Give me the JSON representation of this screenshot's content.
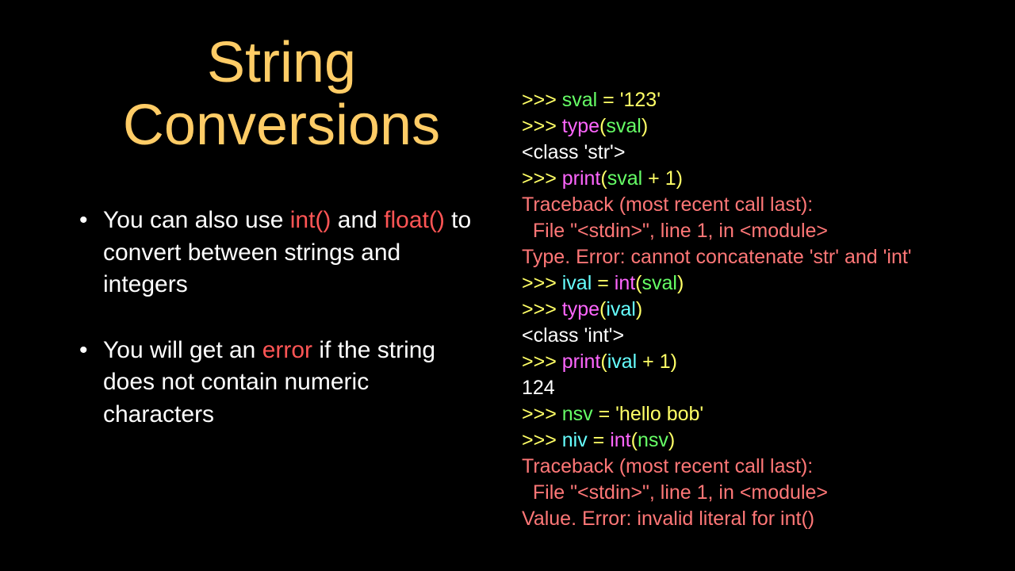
{
  "title_line1": "String",
  "title_line2": "Conversions",
  "bullets": {
    "b1_pre": "You can also use ",
    "b1_int": "int()",
    "b1_mid": " and ",
    "b1_float": "float()",
    "b1_post": " to convert between strings and integers",
    "b2_pre": "You will get an ",
    "b2_err": "error",
    "b2_post": " if the string does not contain numeric characters"
  },
  "code": {
    "l01": {
      "a": ">>> ",
      "b": "sval",
      "c": " = ",
      "d": "'123'"
    },
    "l02": {
      "a": ">>> ",
      "b": "type",
      "c": "(",
      "d": "sval",
      "e": ")"
    },
    "l03": {
      "a": "<class 'str'>"
    },
    "l04": {
      "a": ">>> ",
      "b": "print",
      "c": "(",
      "d": "sval",
      "e": " + ",
      "f": "1",
      "g": ")"
    },
    "l05": {
      "a": "Traceback (most recent call last):"
    },
    "l06": {
      "a": "  File \"<stdin>\", line 1, in <module>"
    },
    "l07": {
      "a": "Type. Error: cannot concatenate 'str' and 'int'"
    },
    "l08": {
      "a": ">>> ",
      "b": "ival",
      "c": " = ",
      "d": "int",
      "e": "(",
      "f": "sval",
      "g": ")"
    },
    "l09": {
      "a": ">>> ",
      "b": "type",
      "c": "(",
      "d": "ival",
      "e": ")"
    },
    "l10": {
      "a": "<class 'int'>"
    },
    "l11": {
      "a": ">>> ",
      "b": "print",
      "c": "(",
      "d": "ival",
      "e": " + ",
      "f": "1",
      "g": ")"
    },
    "l12": {
      "a": "124"
    },
    "l13": {
      "a": ">>> ",
      "b": "nsv",
      "c": " = ",
      "d": "'hello bob'"
    },
    "l14": {
      "a": ">>> ",
      "b": "niv",
      "c": " = ",
      "d": "int",
      "e": "(",
      "f": "nsv",
      "g": ")"
    },
    "l15": {
      "a": "Traceback (most recent call last):"
    },
    "l16": {
      "a": "  File \"<stdin>\", line 1, in <module>"
    },
    "l17": {
      "a": "Value. Error: invalid literal for int()"
    }
  }
}
